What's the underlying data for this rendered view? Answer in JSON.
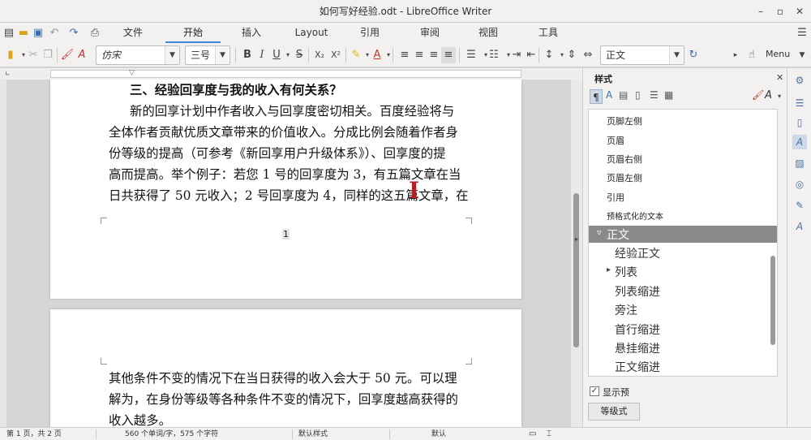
{
  "window": {
    "title": "如何写好经验.odt - LibreOffice Writer",
    "minimize": "–",
    "maximize": "▫",
    "close": "✕"
  },
  "tabs": [
    "文件",
    "开始",
    "插入",
    "Layout",
    "引用",
    "审阅",
    "视图",
    "工具"
  ],
  "active_tab": "开始",
  "toolbar": {
    "font_name": "仿宋",
    "font_size": "三号",
    "bold": "B",
    "italic": "I",
    "underline": "U",
    "strike": "S",
    "subscript": "X₂",
    "superscript": "X²",
    "paragraph_style": "正文",
    "menu_label": "Menu"
  },
  "document": {
    "page1_lines": [
      "三、经验回享度与我的收入有何关系？",
      "新的回享计划中作者收入与回享度密切相关。百度经验将与",
      "全体作者贡献优质文章带来的价值收入。分成比例会随着作者身",
      "份等级的提高（可参考《新回享用户升级体系》）、回享度的提",
      "高而提高。举个例子：若您 1 号的回享度为 3，有五篇文章在当",
      "日共获得了 50 元收入；2 号回享度为 4，同样的这五篇文章，在"
    ],
    "page1_number": "1",
    "page2_lines": [
      "其他条件不变的情况下在当日获得的收入会大于 50 元。可以理",
      "解为，在身份等级等各种条件不变的情况下，回享度越高获得的",
      "收入越多。"
    ]
  },
  "sidebar": {
    "title": "样式",
    "styles": [
      "页脚左侧",
      "页眉",
      "页眉右侧",
      "页眉左侧",
      "引用",
      "预格式化的文本"
    ],
    "selected_style": "正文",
    "sub_styles": [
      "经验正文",
      "列表",
      "列表缩进",
      "旁注",
      "首行缩进",
      "悬挂缩进",
      "正文缩进"
    ],
    "show_preview_label": "显示预",
    "hierarchy_button": "等级式"
  },
  "status": {
    "page": "第 1 页，共 2 页",
    "words": "560 个单词/字，575 个字符",
    "page_style": "默认样式",
    "language": "默认"
  },
  "colors": {
    "accent": "#3a8bd8",
    "selected_row": "#8a8a8a",
    "chrome": "#f2f1f0",
    "cursor": "#b22222"
  }
}
